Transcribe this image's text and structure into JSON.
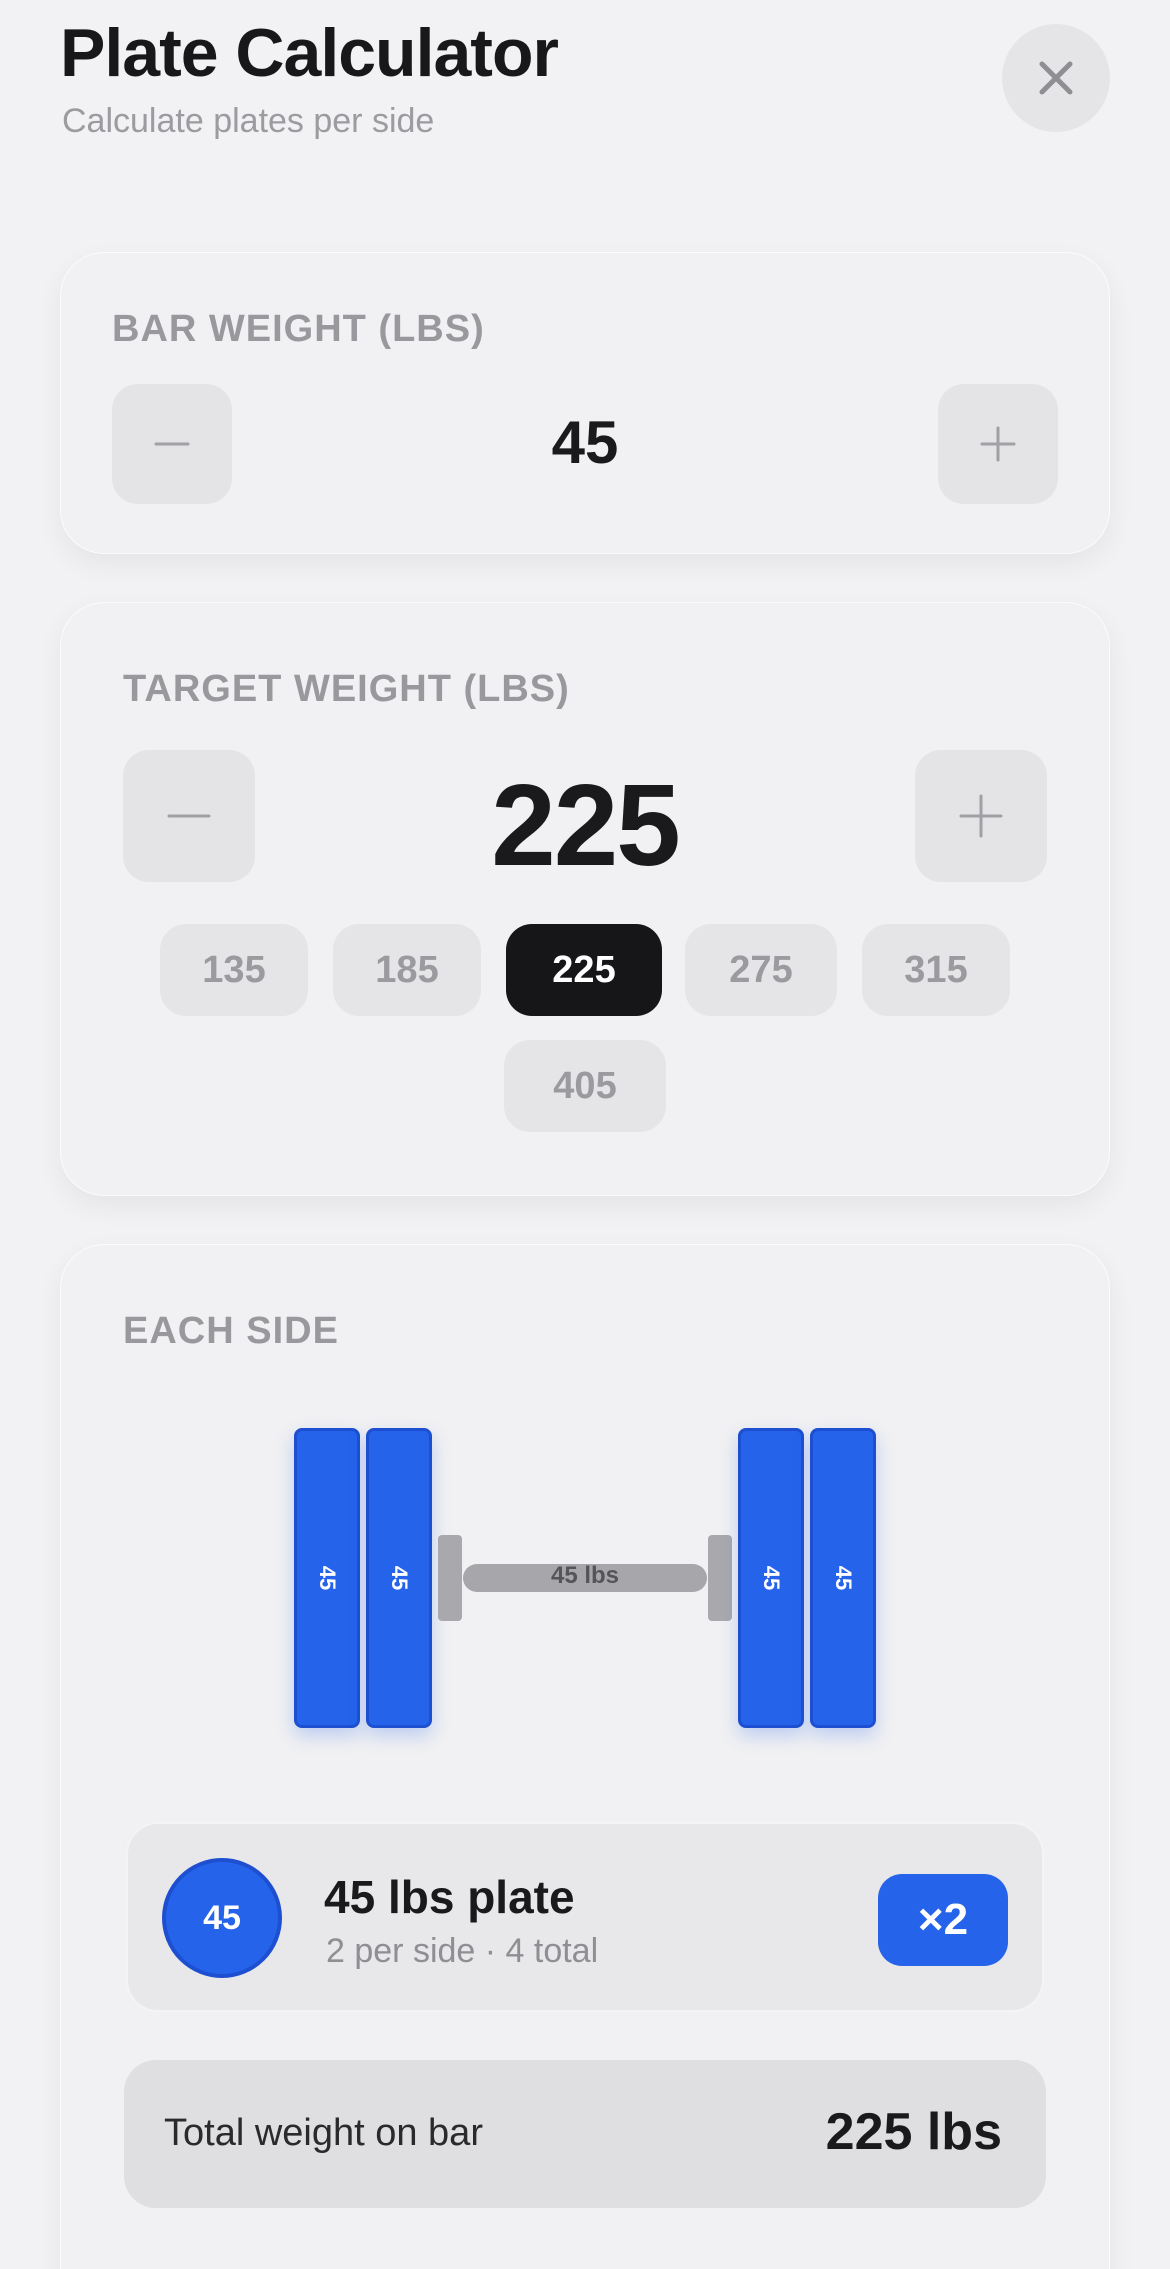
{
  "header": {
    "title": "Plate Calculator",
    "subtitle": "Calculate plates per side",
    "close_icon": "close-icon"
  },
  "bar_weight": {
    "label": "BAR WEIGHT (LBS)",
    "value": "45",
    "decrement_icon": "minus-icon",
    "increment_icon": "plus-icon"
  },
  "target_weight": {
    "label": "TARGET WEIGHT (LBS)",
    "value": "225",
    "presets": [
      "135",
      "185",
      "225",
      "275",
      "315",
      "405"
    ],
    "selected_preset": "225"
  },
  "each_side": {
    "label": "EACH SIDE",
    "left_plates": [
      "45",
      "45"
    ],
    "right_plates": [
      "45",
      "45"
    ],
    "bar_label": "45 lbs",
    "plate_summary": {
      "badge": "45",
      "name": "45 lbs plate",
      "detail": "2 per side · 4 total",
      "count": "×2"
    },
    "total_label": "Total weight on bar",
    "total_value": "225 lbs"
  },
  "colors": {
    "accent": "#2563eb",
    "selected_chip": "#161618",
    "background": "#f2f2f4"
  }
}
